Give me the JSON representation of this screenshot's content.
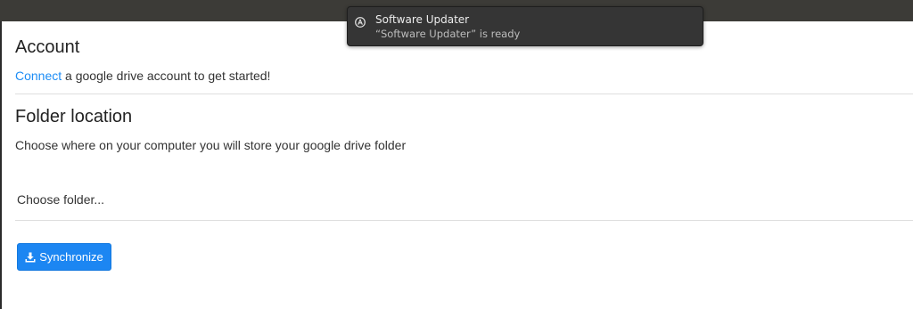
{
  "account": {
    "heading": "Account",
    "connect_link": "Connect",
    "connect_text": " a google drive account to get started!"
  },
  "folder": {
    "heading": "Folder location",
    "description": "Choose where on your computer you will store your google drive folder",
    "choose_label": "Choose folder..."
  },
  "sync": {
    "button_label": "Synchronize",
    "icon": "download-icon"
  },
  "notification": {
    "icon": "software-updater-icon",
    "title": "Software Updater",
    "body": "“Software Updater” is ready"
  },
  "colors": {
    "accent": "#1c86f2",
    "link": "#1d8df5",
    "topbar": "#3c3b37",
    "notification_bg": "#353535"
  }
}
